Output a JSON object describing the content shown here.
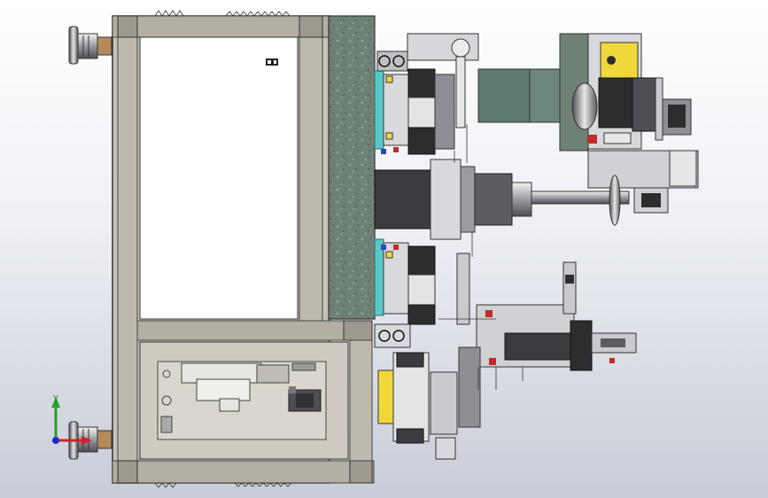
{
  "viewport": {
    "background_top": "#ffffff",
    "background_bottom": "#c9cbd6"
  },
  "triad": {
    "y_label": "Y",
    "x_color": "#d0202a",
    "y_color": "#22a02a",
    "z_color": "#1e2ad0"
  },
  "colors": {
    "frame_fill": "#c8c4b8",
    "frame_edge": "#3a3a3a",
    "granite": "#6e7f74",
    "machine_dark": "#2d2d2f",
    "machine_mid": "#8d8f94",
    "machine_light": "#d8d9dc",
    "accent_cyan": "#59c7c7",
    "accent_yellow": "#f0d83a",
    "accent_red": "#c42a2a",
    "accent_blue": "#3248b8"
  },
  "icons": {
    "leveling_foot": "leveling-foot-icon",
    "servo_motor": "servo-motor-icon"
  }
}
